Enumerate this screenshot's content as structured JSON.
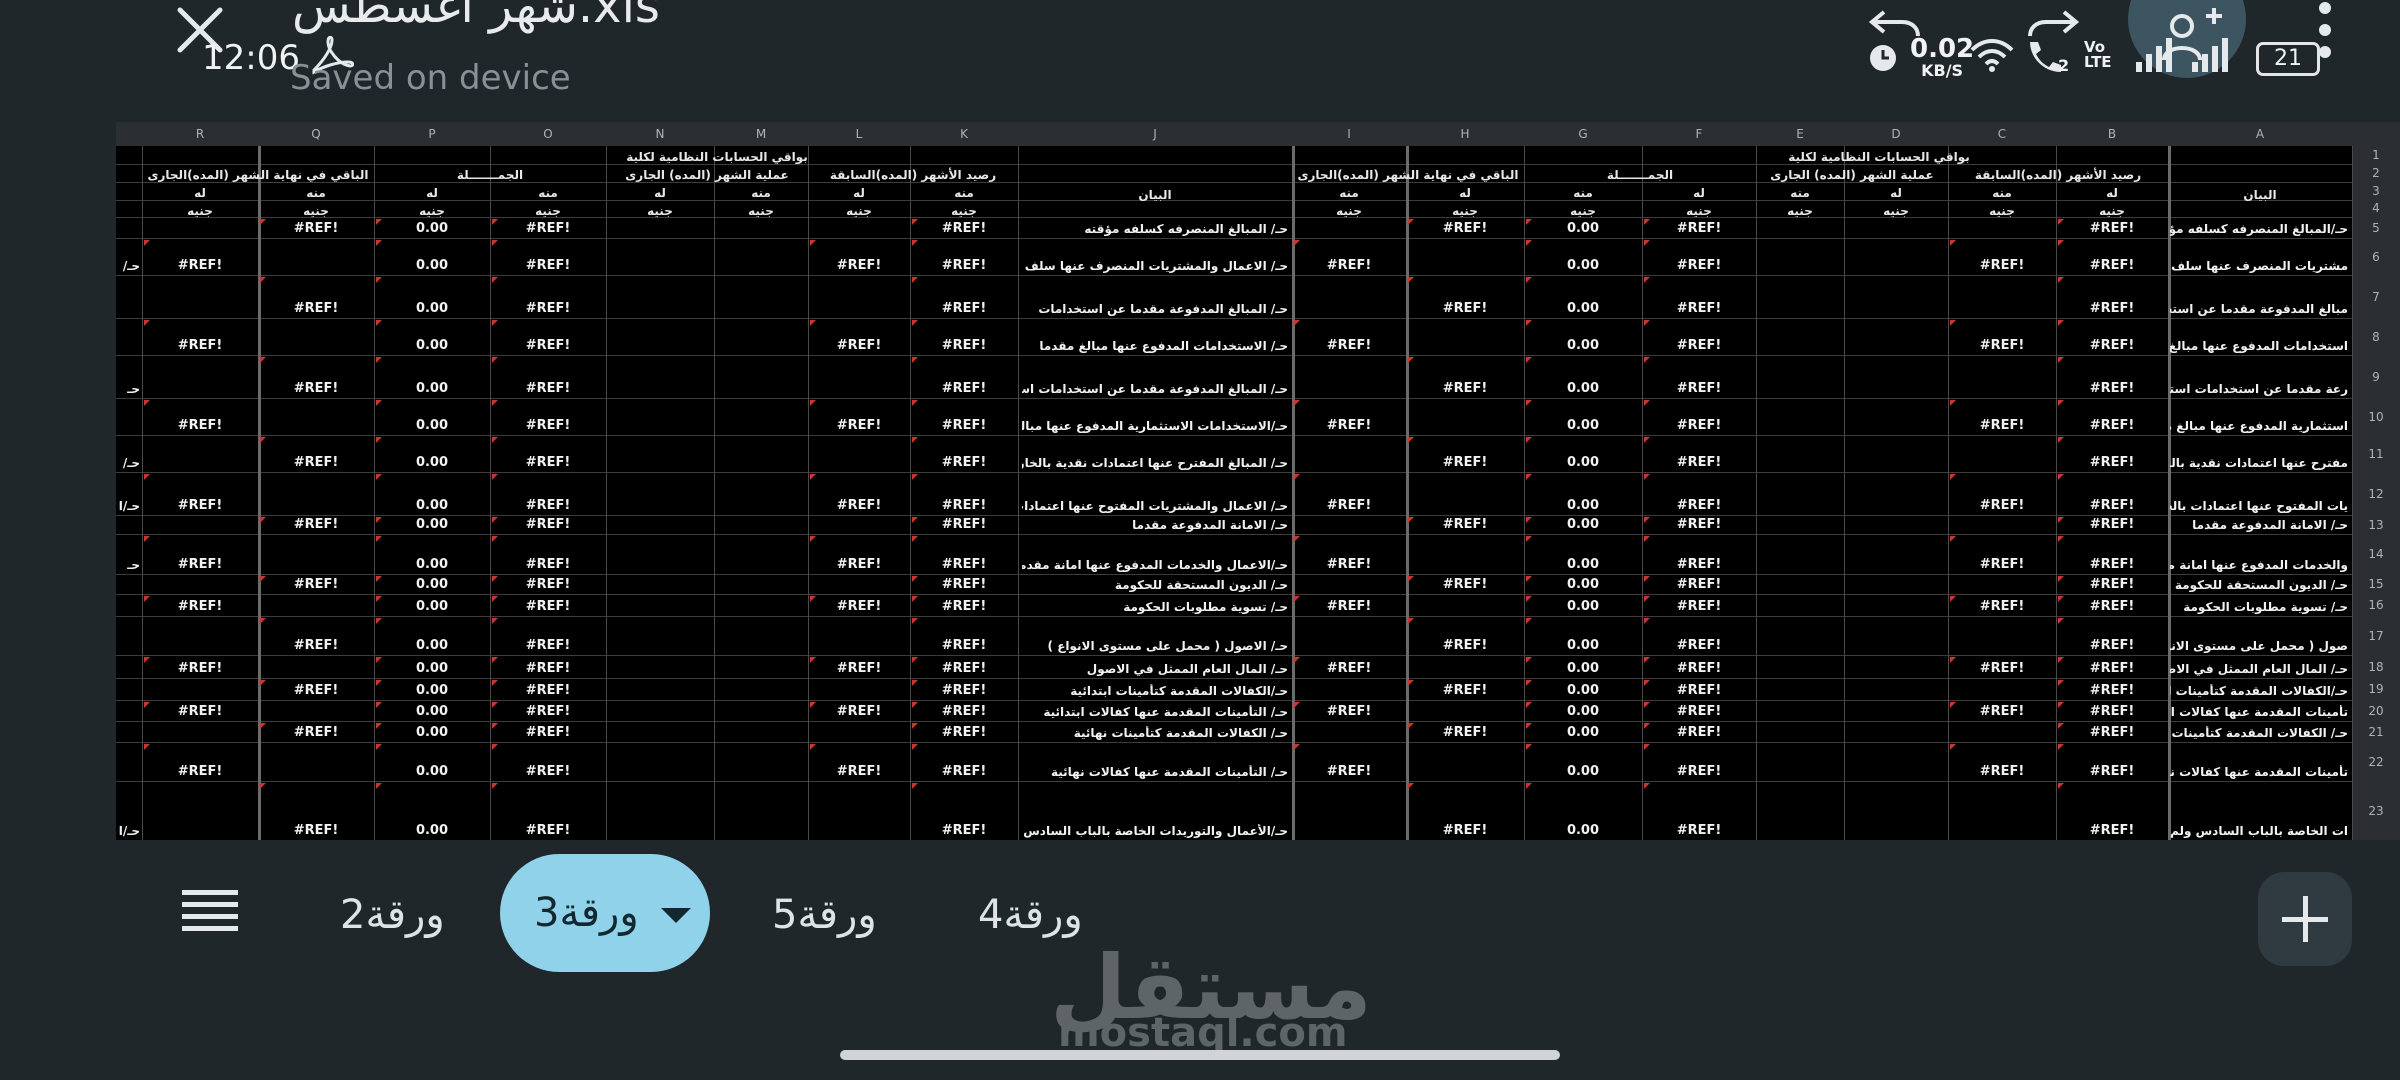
{
  "app": {
    "title": "شهر اغسطس.xls",
    "saved_status": "Saved on device",
    "close_icon": "close-icon",
    "pdf_icon": "acrobat-icon"
  },
  "status_bar": {
    "time": "12:06",
    "net_speed": "0.02",
    "net_unit": "KB/S",
    "volte": "Vo LTE",
    "sim_number": "2",
    "battery": "21"
  },
  "sheet": {
    "columns": [
      "R",
      "Q",
      "P",
      "O",
      "N",
      "M",
      "L",
      "K",
      "J",
      "I",
      "H",
      "G",
      "F",
      "E",
      "D",
      "C",
      "B",
      "A"
    ],
    "rows": [
      "1",
      "2",
      "3",
      "4",
      "5",
      "6",
      "7",
      "8",
      "9",
      "10",
      "11",
      "12",
      "13",
      "14",
      "15",
      "16",
      "17",
      "18",
      "19",
      "20",
      "21",
      "22",
      "23"
    ],
    "header_left": "بواقي الحسابات النظامية لكلية",
    "header_right": "بواقي الحسابات النظامية لكلية",
    "group_headers": {
      "balance_end": "الباقي في نهاية الشهر (المده)الجارى",
      "totals": "الجمـــــــلة",
      "month_ops": "عملية الشهر (المده) الجارى",
      "prev_balance": "رصيد الأشهر (المده)السابقة",
      "statement": "البيان"
    },
    "sub_from": "منه",
    "sub_to": "له",
    "sub_unit": "جنيه",
    "ref_value": "#REF!",
    "zero_value": "0.00",
    "descriptions_J": [
      "حـ/ المبالغ المنصرفه كسلفه مؤقته",
      "حـ/ الاعمال والمشتريات المنصرف عنها سلف مؤقته",
      "حـ/ المبالغ المدفوعة مقدما عن استخدامات",
      "حـ/ الاستخدامات المدفوع عنها مبالغ مقدما",
      "حـ/ المبالغ المدفوعة مقدما عن استخدامات استثماريه",
      "حـ/الاستخدامات الاستثمارية المدفوع عنها مبالغ مقدما",
      "حـ/ المبالغ المفترح عنها اعتمادات نقدية بالخارج",
      "حـ/ الاعمال والمشتريات المفتوح عنها اعتمادات بالخارج",
      "حـ/ الامانة المدفوعة مقدما",
      "حـ/الاعمال والخدمات المدفوع عنها امانة مقدما",
      "حـ/ الديون المستحقة للحكومة",
      "حـ/ تسوية مطلوبات الحكومة",
      "حـ/ الاصول ( محمل على مستوى الانواع )",
      "حـ/ المال العام الممثل في الاصول",
      "حـ/الكفالات المقدمة كتأمينات ابتدائية",
      "حـ/ التأمينات المقدمة عنها كفالات ابتدائية",
      "حـ/ الكفالات المقدمة كتأمينات نهائية",
      "حـ/ التأمينات المقدمة عنها كفالات نهائية",
      "حـ/الأعمال والتوريدات الخاصة بالباب السادس ولم تسدد"
    ],
    "descriptions_A": [
      "حـ/المبالغ المنصرفه كسلفه مؤقته",
      "مشتريات المنصرف عنها سلف مؤقته",
      "مبالغ المدفوعة مقدما عن استخدامات",
      "استخدامات المدفوع عنها مبالغ مقدما",
      "رعة مقدما عن استخدامات استثماريه",
      "استثمارية المدفوع عنها مبالغ مقدما",
      "مفترح عنها اعتمادات نقدية بالخارج",
      "يات المفتوح عنها اعتمادات بالخارج",
      "حـ/ الامانة المدفوعة مقدما",
      "والخدمات المدفوع عنها امانة مقدما",
      "حـ/ الديون المستحقة للحكومة",
      "حـ/ تسوية مطلوبات الحكومة",
      "صول ( محمل على مستوى الانواع )",
      "حـ/ المال العام الممثل في الاصول",
      "حـ/الكفالات المقدمة كتأمينات ابتدائية",
      "تأمينات المقدمة عنها كفالات ابتدائية",
      "حـ/ الكفالات المقدمة كتأمينات نهائية",
      "تأمينات المقدمة عنها كفالات نهائية",
      "ات الخاصة بالباب السادس ولم تسدد"
    ],
    "left_edge_fragments": [
      "حـ/",
      "حـ",
      "حـ/",
      "حـ/ا",
      "حـ",
      "حـ/ا"
    ]
  },
  "tabs": {
    "items": [
      {
        "label": "ورقة2"
      },
      {
        "label": "ورقة3"
      },
      {
        "label": "ورقة5"
      },
      {
        "label": "ورقة4"
      }
    ],
    "active_index": 1,
    "menu_icon": "list-icon",
    "add_icon": "plus-icon"
  },
  "watermark": {
    "arabic": "مستقل",
    "latin": "mostaql.com"
  }
}
